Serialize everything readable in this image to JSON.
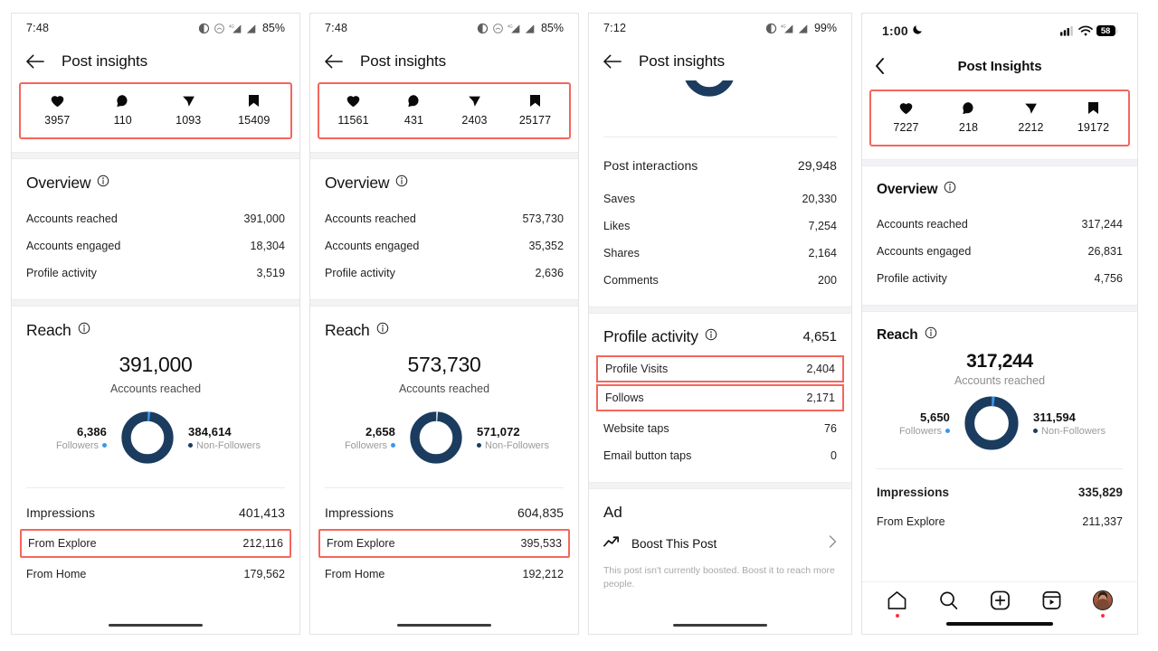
{
  "panels": [
    {
      "id": "panel-1",
      "platform": "android",
      "status": {
        "time": "7:48",
        "battery": "85%"
      },
      "nav": {
        "title": "Post insights"
      },
      "engagement": [
        {
          "icon": "heart-icon",
          "value": "3957"
        },
        {
          "icon": "comment-icon",
          "value": "110"
        },
        {
          "icon": "share-icon",
          "value": "1093"
        },
        {
          "icon": "save-icon",
          "value": "15409"
        }
      ],
      "overview": {
        "title": "Overview",
        "rows": [
          {
            "label": "Accounts reached",
            "value": "391,000"
          },
          {
            "label": "Accounts engaged",
            "value": "18,304"
          },
          {
            "label": "Profile activity",
            "value": "3,519"
          }
        ]
      },
      "reach": {
        "title": "Reach",
        "big_value": "391,000",
        "big_label": "Accounts reached",
        "followers_value": "6,386",
        "followers_label": "Followers",
        "nonfollowers_value": "384,614",
        "nonfollowers_label": "Non-Followers",
        "rows": [
          {
            "label": "Impressions",
            "value": "401,413",
            "highlight": false
          },
          {
            "label": "From Explore",
            "value": "212,116",
            "highlight": true
          },
          {
            "label": "From Home",
            "value": "179,562",
            "highlight": false
          }
        ]
      }
    },
    {
      "id": "panel-2",
      "platform": "android",
      "status": {
        "time": "7:48",
        "battery": "85%"
      },
      "nav": {
        "title": "Post insights"
      },
      "engagement": [
        {
          "icon": "heart-icon",
          "value": "11561"
        },
        {
          "icon": "comment-icon",
          "value": "431"
        },
        {
          "icon": "share-icon",
          "value": "2403"
        },
        {
          "icon": "save-icon",
          "value": "25177"
        }
      ],
      "overview": {
        "title": "Overview",
        "rows": [
          {
            "label": "Accounts reached",
            "value": "573,730"
          },
          {
            "label": "Accounts engaged",
            "value": "35,352"
          },
          {
            "label": "Profile activity",
            "value": "2,636"
          }
        ]
      },
      "reach": {
        "title": "Reach",
        "big_value": "573,730",
        "big_label": "Accounts reached",
        "followers_value": "2,658",
        "followers_label": "Followers",
        "nonfollowers_value": "571,072",
        "nonfollowers_label": "Non-Followers",
        "rows": [
          {
            "label": "Impressions",
            "value": "604,835",
            "highlight": false
          },
          {
            "label": "From Explore",
            "value": "395,533",
            "highlight": true
          },
          {
            "label": "From Home",
            "value": "192,212",
            "highlight": false
          }
        ]
      }
    },
    {
      "id": "panel-3",
      "platform": "android",
      "status": {
        "time": "7:12",
        "battery": "99%"
      },
      "nav": {
        "title": "Post insights"
      },
      "interactions": {
        "header": {
          "label": "Post interactions",
          "value": "29,948"
        },
        "rows": [
          {
            "label": "Saves",
            "value": "20,330"
          },
          {
            "label": "Likes",
            "value": "7,254"
          },
          {
            "label": "Shares",
            "value": "2,164"
          },
          {
            "label": "Comments",
            "value": "200"
          }
        ]
      },
      "profile_activity": {
        "title": "Profile activity",
        "total": "4,651",
        "rows": [
          {
            "label": "Profile Visits",
            "value": "2,404",
            "highlight": true
          },
          {
            "label": "Follows",
            "value": "2,171",
            "highlight": true
          },
          {
            "label": "Website taps",
            "value": "76",
            "highlight": false
          },
          {
            "label": "Email button taps",
            "value": "0",
            "highlight": false
          }
        ]
      },
      "ad": {
        "title": "Ad",
        "boost_label": "Boost This Post",
        "note": "This post isn't currently boosted. Boost it to reach more people."
      }
    },
    {
      "id": "panel-4",
      "platform": "ios",
      "status": {
        "time": "1:00",
        "battery": "58"
      },
      "nav": {
        "title": "Post Insights"
      },
      "engagement": [
        {
          "icon": "heart-icon",
          "value": "7227"
        },
        {
          "icon": "comment-icon",
          "value": "218"
        },
        {
          "icon": "share-icon",
          "value": "2212"
        },
        {
          "icon": "save-icon",
          "value": "19172"
        }
      ],
      "overview": {
        "title": "Overview",
        "rows": [
          {
            "label": "Accounts reached",
            "value": "317,244"
          },
          {
            "label": "Accounts engaged",
            "value": "26,831"
          },
          {
            "label": "Profile activity",
            "value": "4,756"
          }
        ]
      },
      "reach": {
        "title": "Reach",
        "big_value": "317,244",
        "big_label": "Accounts reached",
        "followers_value": "5,650",
        "followers_label": "Followers",
        "nonfollowers_value": "311,594",
        "nonfollowers_label": "Non-Followers",
        "rows": [
          {
            "label": "Impressions",
            "value": "335,829",
            "highlight": false,
            "bold": true
          },
          {
            "label": "From Explore",
            "value": "211,337",
            "highlight": false,
            "bold": false
          }
        ]
      },
      "tabbar": [
        {
          "icon": "home-icon",
          "badge": true
        },
        {
          "icon": "search-icon",
          "badge": false
        },
        {
          "icon": "add-icon",
          "badge": false
        },
        {
          "icon": "reels-icon",
          "badge": false
        },
        {
          "icon": "profile-avatar-icon",
          "badge": true
        }
      ]
    }
  ],
  "colors": {
    "highlight_border": "#f4665c",
    "donut_nonfollowers": "#1b3c5f",
    "donut_followers": "#3897f0",
    "badge_red": "#ff3040"
  },
  "chart_data": [
    {
      "type": "pie",
      "title": "Reach breakdown",
      "panel": "panel-1",
      "categories": [
        "Followers",
        "Non-Followers"
      ],
      "values": [
        6386,
        384614
      ],
      "total": 391000,
      "colors": [
        "#3897f0",
        "#1b3c5f"
      ],
      "legend": "sides"
    },
    {
      "type": "pie",
      "title": "Reach breakdown",
      "panel": "panel-2",
      "categories": [
        "Followers",
        "Non-Followers"
      ],
      "values": [
        2658,
        571072
      ],
      "total": 573730,
      "colors": [
        "#3897f0",
        "#1b3c5f"
      ],
      "legend": "sides"
    },
    {
      "type": "pie",
      "title": "Reach breakdown",
      "panel": "panel-4",
      "categories": [
        "Followers",
        "Non-Followers"
      ],
      "values": [
        5650,
        311594
      ],
      "total": 317244,
      "colors": [
        "#3897f0",
        "#1b3c5f"
      ],
      "legend": "sides"
    }
  ]
}
